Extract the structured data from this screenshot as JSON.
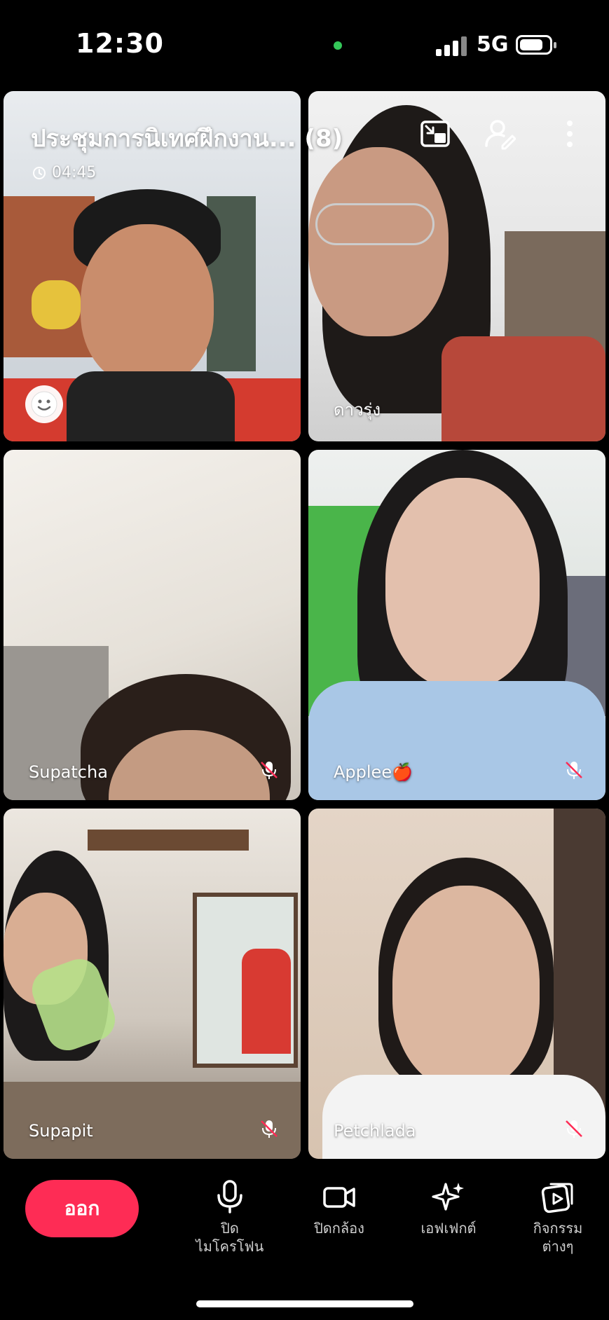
{
  "status_bar": {
    "time": "12:30",
    "network": "5G"
  },
  "meeting": {
    "title": "ประชุมการนิเทศฝึกงาน... (8)",
    "timer": "04:45"
  },
  "participants": [
    {
      "name": ""
    },
    {
      "name": "ดาวรุ่ง"
    },
    {
      "name": "Supatcha"
    },
    {
      "name": "Applee🍎"
    },
    {
      "name": "Supapit"
    },
    {
      "name": "Petchlada"
    }
  ],
  "controls": {
    "leave": "ออก",
    "mic": "ปิด\nไมโครโฟน",
    "camera": "ปิดกล้อง",
    "effects": "เอฟเฟกต์",
    "activities": "กิจกรรม\nต่างๆ"
  },
  "colors": {
    "leave_button": "#fe2c55",
    "active_dot": "#34c759"
  }
}
